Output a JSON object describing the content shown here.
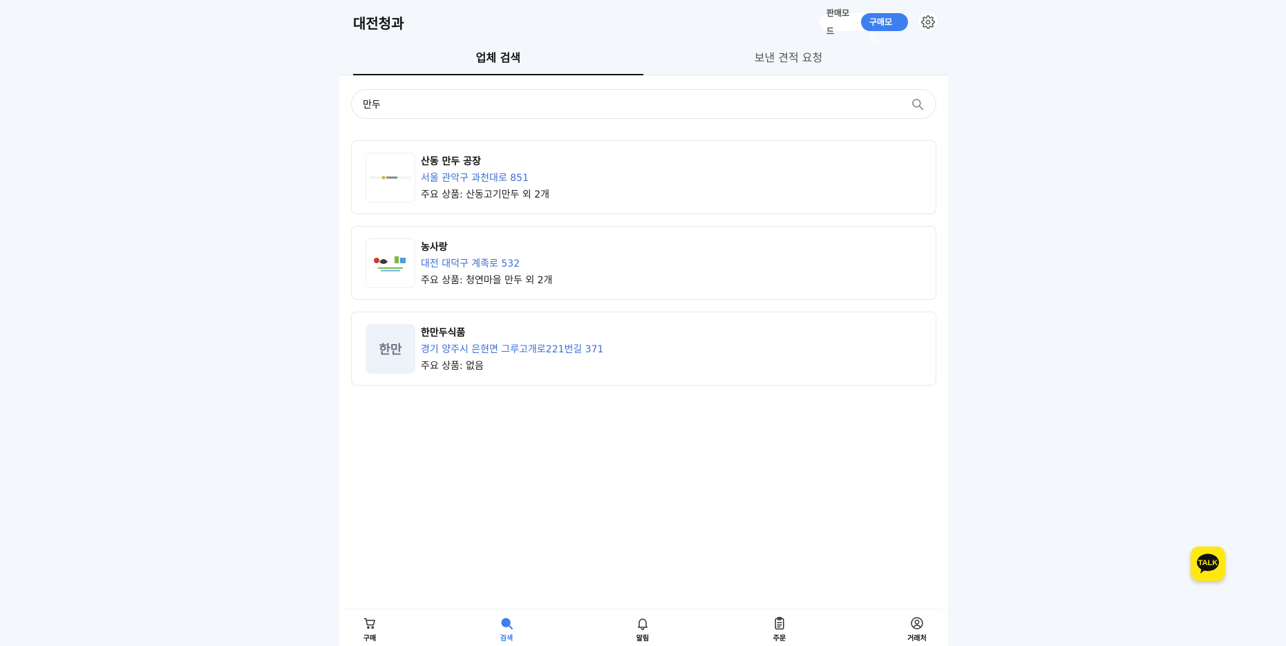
{
  "header": {
    "brand": "대전청과",
    "mode_sell": "판매모드",
    "mode_buy": "구매모드"
  },
  "tabs": [
    {
      "label": "업체 검색",
      "active": true
    },
    {
      "label": "보낸 견적 요청",
      "active": false
    }
  ],
  "search": {
    "value": "만두"
  },
  "results": [
    {
      "name": "산동 만두 공장",
      "address": "서울 관악구 과천대로 851",
      "products": "주요 상품: 산동고기만두 외 2개",
      "thumb": "image"
    },
    {
      "name": "농사랑",
      "address": "대전 대덕구 계족로 532",
      "products": "주요 상품: 청연마을 만두 외 2개",
      "thumb": "image"
    },
    {
      "name": "한만두식품",
      "address": "경기 양주시 은현면 그루고개로221번길 371",
      "products": "주요 상품: 없음",
      "thumb_text": "한만"
    }
  ],
  "bottom_nav": [
    {
      "label": "구매",
      "icon": "cart-icon"
    },
    {
      "label": "검색",
      "icon": "search-icon",
      "active": true
    },
    {
      "label": "알림",
      "icon": "bell-icon"
    },
    {
      "label": "주문",
      "icon": "clipboard-icon"
    },
    {
      "label": "거래처",
      "icon": "user-circle-icon"
    }
  ],
  "talk_button": {
    "label": "TALK"
  },
  "colors": {
    "accent": "#3d7ff0",
    "address_link": "#3b6fd8",
    "kakao_yellow": "#ffe812",
    "background": "#f4f7fb"
  }
}
